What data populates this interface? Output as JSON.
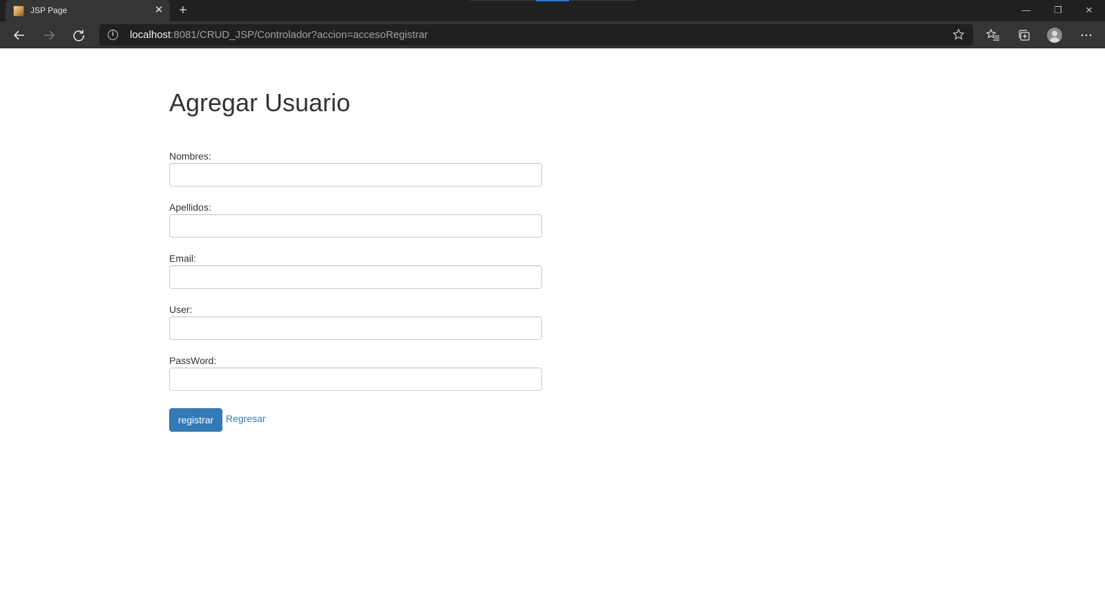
{
  "browser": {
    "tab_title": "JSP Page",
    "tab_close_glyph": "✕",
    "new_tab_glyph": "+",
    "url_host": "localhost",
    "url_rest": ":8081/CRUD_JSP/Controlador?accion=accesoRegistrar",
    "window_controls": {
      "minimize": "—",
      "restore": "❐",
      "close": "✕"
    },
    "icons": [
      "back-arrow-icon",
      "forward-arrow-icon",
      "refresh-icon",
      "info-icon",
      "star-icon",
      "favorites-icon",
      "collections-icon",
      "profile-icon",
      "more-icon"
    ]
  },
  "page": {
    "title": "Agregar Usuario",
    "fields": [
      {
        "label": "Nombres:",
        "value": "",
        "placeholder": ""
      },
      {
        "label": "Apellidos:",
        "value": "",
        "placeholder": ""
      },
      {
        "label": "Email:",
        "value": "",
        "placeholder": ""
      },
      {
        "label": "User:",
        "value": "",
        "placeholder": ""
      },
      {
        "label": "PassWord:",
        "value": "",
        "placeholder": ""
      }
    ],
    "submit_label": "registrar",
    "back_link": "Regresar"
  },
  "colors": {
    "chrome_dark": "#202020",
    "chrome_toolbar": "#353535",
    "primary": "#337ab7",
    "text": "#333333"
  }
}
